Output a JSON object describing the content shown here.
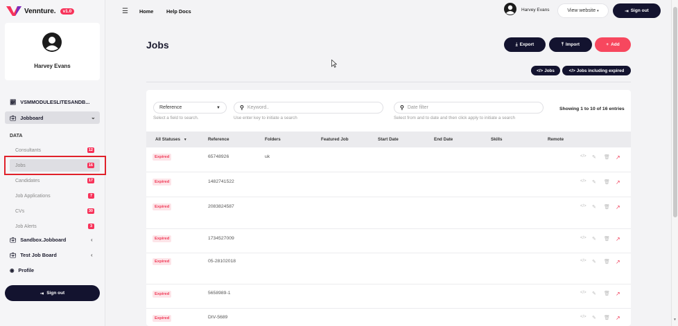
{
  "brand": {
    "name": "Vennture.",
    "version": "v1.0"
  },
  "profile": {
    "name": "Harvey Evans"
  },
  "sidebar": {
    "org": "VSMMODULESLITESANDB...",
    "jobboard": "Jobboard",
    "data_label": "DATA",
    "items": [
      {
        "label": "Consultants",
        "count": "12"
      },
      {
        "label": "Jobs",
        "count": "16"
      },
      {
        "label": "Candidates",
        "count": "17"
      },
      {
        "label": "Job Applications",
        "count": "7"
      },
      {
        "label": "CVs",
        "count": "30"
      },
      {
        "label": "Job Alerts",
        "count": "3"
      }
    ],
    "sandbox": "Sandbox.Jobboard",
    "test_board": "Test Job Board",
    "profile_link": "Profile",
    "signout": "Sign out"
  },
  "topbar": {
    "home": "Home",
    "help": "Help Docs",
    "user": "Harvey Evans",
    "view_website": "View website",
    "signout": "Sign out"
  },
  "page": {
    "title": "Jobs",
    "export": "Export",
    "import": "Import",
    "add": "Add",
    "tab_jobs": "Jobs",
    "tab_expired": "Jobs including expired"
  },
  "filters": {
    "field_value": "Reference",
    "field_help": "Select a field to search.",
    "keyword_placeholder": "Keyword..",
    "keyword_help": "Use enter key to initiate a search",
    "date_placeholder": "Date filter",
    "date_help": "Select from and to date and then click apply to initiate a search",
    "showing": "Showing 1 to 10 of 16 entries"
  },
  "table": {
    "headers": [
      "All Statuses",
      "Reference",
      "Folders",
      "Featured Job",
      "Start Date",
      "End Date",
      "Skills",
      "Remote"
    ],
    "rows": [
      {
        "status": "Expired",
        "reference": "65748926",
        "folders": "uk"
      },
      {
        "status": "Expired",
        "reference": "1482741522",
        "folders": ""
      },
      {
        "status": "Expired",
        "reference": "2083824587",
        "folders": ""
      },
      {
        "status": "Expired",
        "reference": "1734527009",
        "folders": ""
      },
      {
        "status": "Expired",
        "reference": "05-28102018",
        "folders": ""
      },
      {
        "status": "Expired",
        "reference": "5658989-1",
        "folders": ""
      },
      {
        "status": "Expired",
        "reference": "DIV-5689",
        "folders": ""
      }
    ]
  },
  "colors": {
    "accent": "#f7335a",
    "dark": "#13132f",
    "highlight": "#e0202a"
  }
}
